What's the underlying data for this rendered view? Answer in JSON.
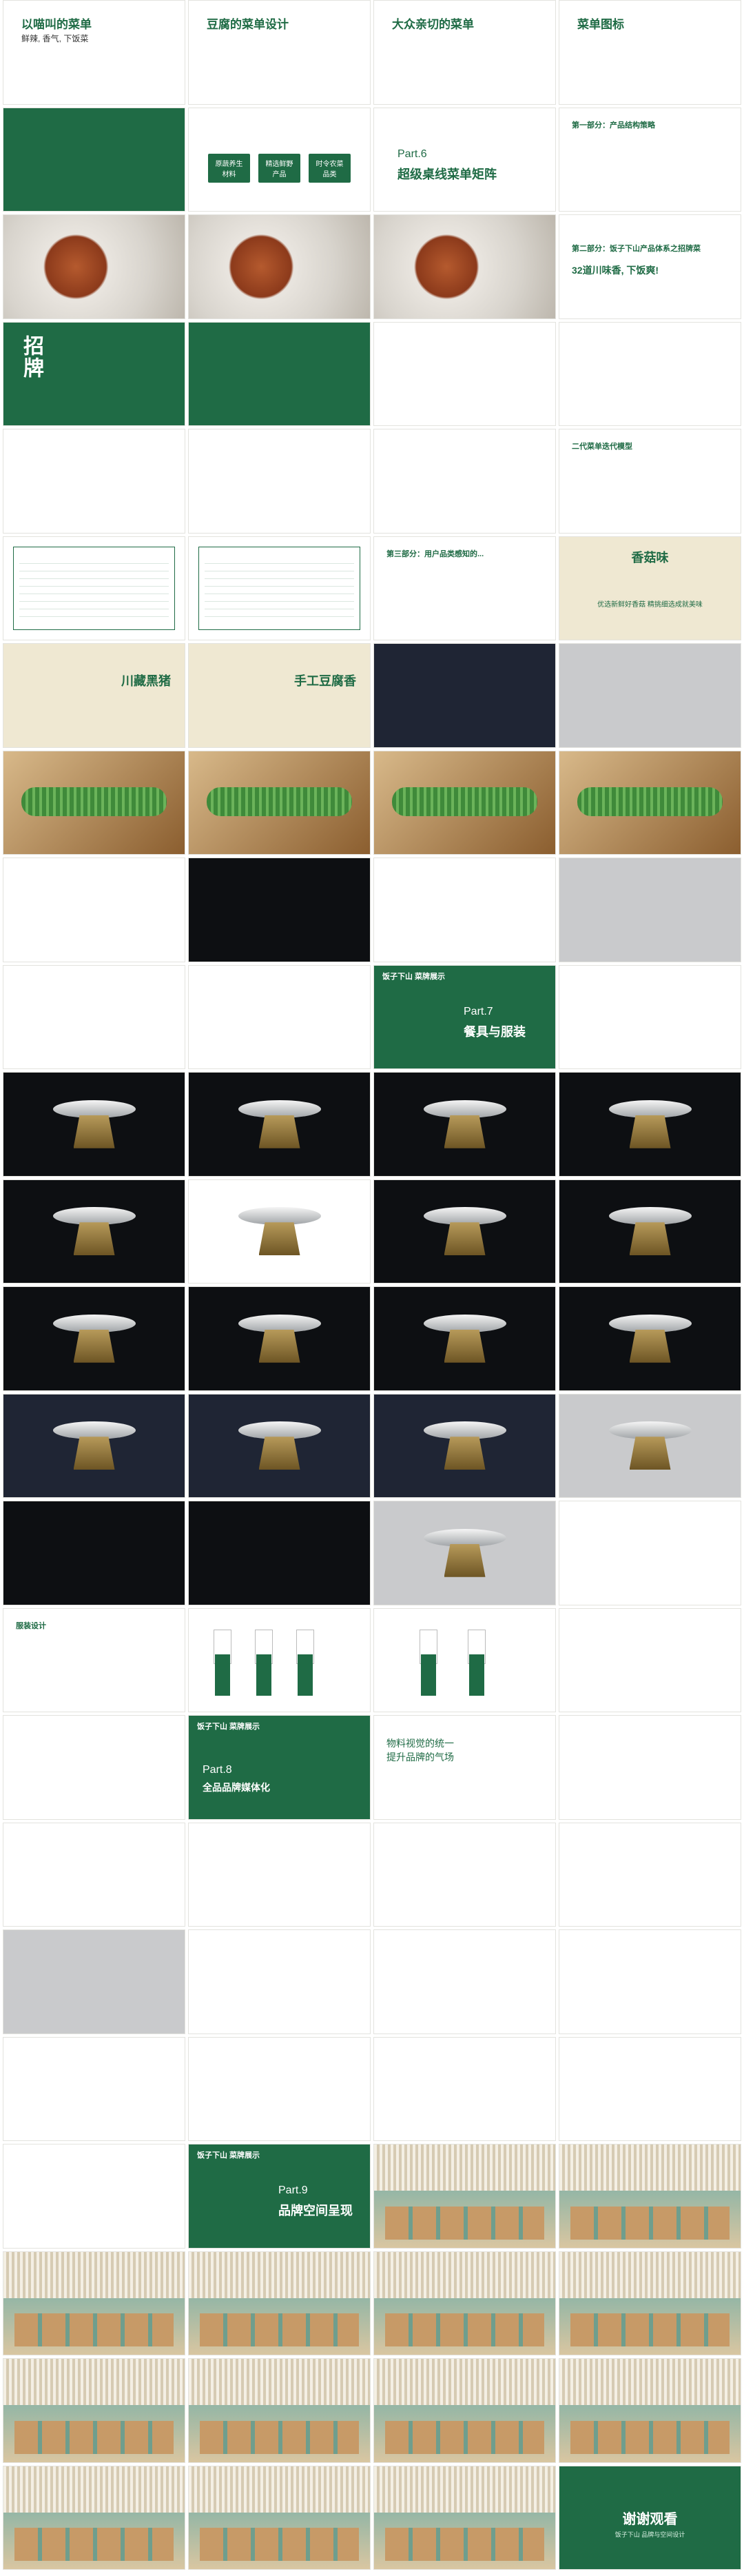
{
  "texts": {
    "t01_title": "以喵叫的菜单",
    "t01_sub": "鲜辣, 香气, 下饭菜",
    "t02_title": "豆腐的菜单设计",
    "t03_title": "大众亲切的菜单",
    "t04_title": "菜单图标",
    "t05_title": "第一部分：产品结构策略",
    "p6_label": "Part.6",
    "p6_name": "超级桌线菜单矩阵",
    "chips": [
      "原蔬养生材料",
      "精选鲜野产品",
      "时令农菜品类"
    ],
    "section_text": "第二部分：饭子下山产品体系之招牌菜",
    "section_big": "32道川味香, 下饭爽!",
    "menu_change": "二代菜单迭代模型",
    "third_part": "第三部分：用户品类感知的...",
    "xiangmo": "香菇味",
    "xiangmo_sub": "优选新鲜好香菇\n精挑细选成就美味",
    "cuan": "川藏黑猪",
    "shougong": "手工豆腐香",
    "brand": "饭子下山\n菜牌展示",
    "p7_label": "Part.7",
    "p7_name": "餐具与服装",
    "clothes_title": "服装设计",
    "p8_label": "Part.8",
    "p8_name": "全品品牌媒体化",
    "vision_big": "物料视觉的统一\n提升品牌的气场",
    "p9_label": "Part.9",
    "p9_name": "品牌空间呈现",
    "thanks": "谢谢观看",
    "thanks_sub": "饭子下山 品牌与空间设计"
  }
}
